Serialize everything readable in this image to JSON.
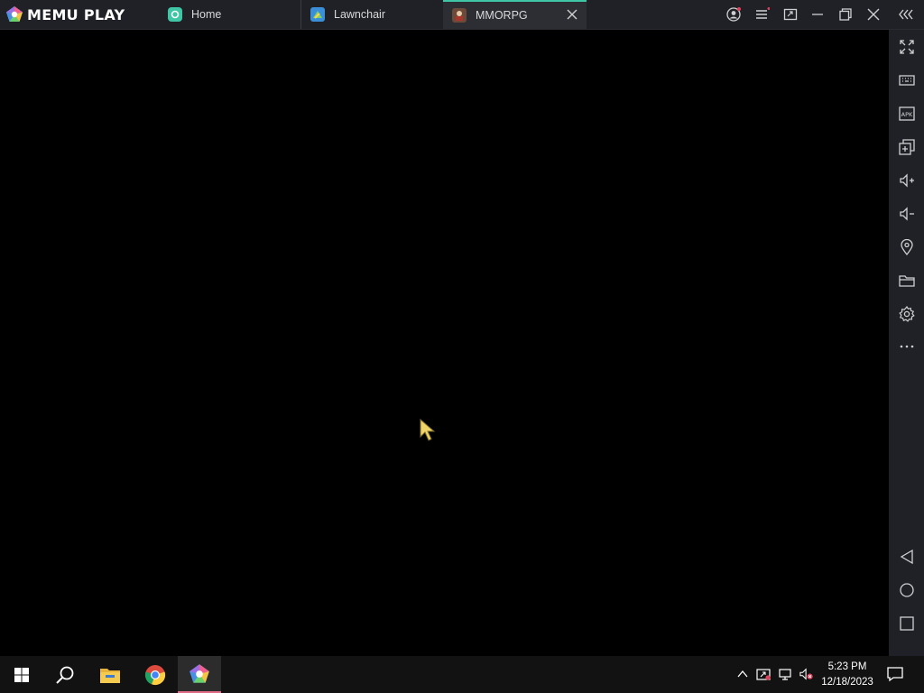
{
  "app": {
    "logo_text": "MEMU PLAY"
  },
  "tabs": [
    {
      "label": "Home",
      "icon": "home-app-icon",
      "active": false
    },
    {
      "label": "Lawnchair",
      "icon": "lawnchair-app-icon",
      "active": false
    },
    {
      "label": "MMORPG",
      "icon": "mmorpg-app-icon",
      "active": true
    }
  ],
  "titlebar_icons": [
    "account-icon",
    "menu-icon",
    "screen-resize-icon",
    "minimize-icon",
    "restore-icon",
    "close-icon",
    "collapse-sidebar-icon"
  ],
  "sidebar_icons": [
    "fullscreen-icon",
    "keyboard-icon",
    "apk-icon",
    "multi-instance-icon",
    "volume-up-icon",
    "volume-down-icon",
    "location-icon",
    "folder-icon",
    "settings-icon",
    "more-icon",
    "back-icon",
    "home-icon",
    "recents-icon"
  ],
  "sidebar_apk_text": "APK",
  "taskbar": {
    "apps": [
      "windows-start-icon",
      "search-icon",
      "file-explorer-icon",
      "chrome-icon",
      "memu-icon"
    ],
    "time": "5:23 PM",
    "date": "12/18/2023"
  },
  "colors": {
    "titlebar": "#1f2126",
    "active_tab_accent": "#3fc6a4",
    "taskbar": "#121212",
    "memu_taskbar_accent": "#e06c87"
  }
}
